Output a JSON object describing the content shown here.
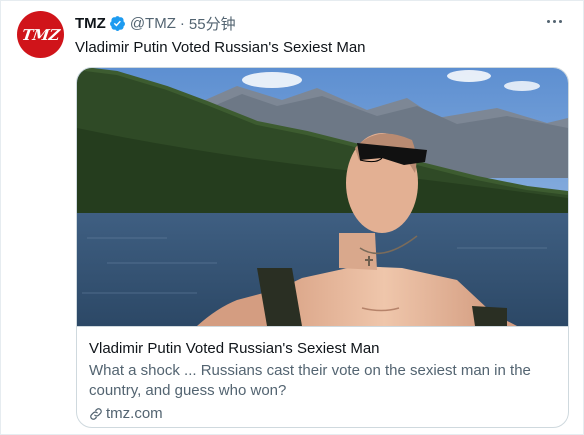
{
  "tweet": {
    "avatar_text": "TMZ",
    "name": "TMZ",
    "handle": "@TMZ",
    "separator": "·",
    "time": "55分钟",
    "text": "Vladimir Putin Voted Russian's Sexiest Man"
  },
  "card": {
    "title": "Vladimir Putin Voted Russian's Sexiest Man",
    "description": "What a shock ... Russians cast their vote on the sexiest man in the country, and guess who won?",
    "domain": "tmz.com"
  },
  "icons": {
    "verified": "verified-badge-icon",
    "more": "more-dots-icon",
    "link": "link-icon"
  },
  "colors": {
    "avatar_bg": "#d0141a",
    "verified_blue": "#1d9bf0",
    "secondary_text": "#536471",
    "border": "#cfd9de"
  }
}
